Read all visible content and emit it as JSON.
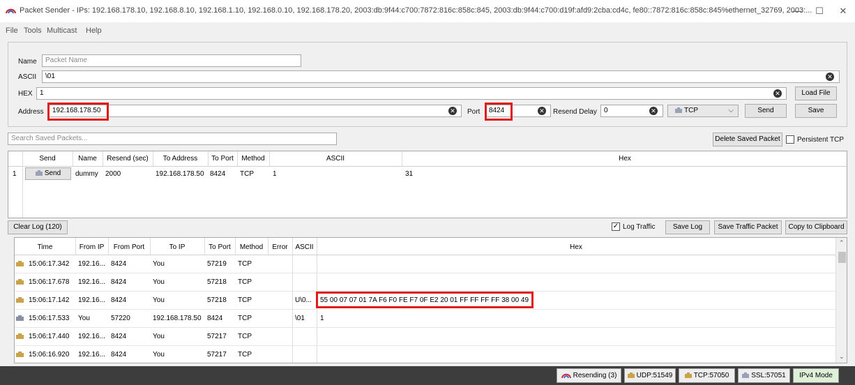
{
  "window": {
    "title": "Packet Sender - IPs: 192.168.178.10, 192.168.8.10, 192.168.1.10, 192.168.0.10, 192.168.178.20, 2003:db:9f44:c700:7872:816c:858c:845, 2003:db:9f44:c700:d19f:afd9:2cba:cd4c, fe80::7872:816c:858c:845%ethernet_32769, 2003:...",
    "minimize": "—",
    "maximize": "☐",
    "close": "✕"
  },
  "menu": [
    "File",
    "Tools",
    "Multicast",
    "Help"
  ],
  "packet_form": {
    "name_label": "Name",
    "name_placeholder": "Packet Name",
    "ascii_label": "ASCII",
    "ascii_value": "\\01",
    "hex_label": "HEX",
    "hex_value": "1",
    "load_file": "Load File",
    "address_label": "Address",
    "address_value": "192.168.178.50",
    "port_label": "Port",
    "port_value": "8424",
    "resend_label": "Resend Delay",
    "resend_value": "0",
    "protocol": "TCP",
    "send": "Send",
    "save": "Save"
  },
  "saved": {
    "search_placeholder": "Search Saved Packets...",
    "delete_button": "Delete Saved Packet",
    "persistent_tcp": "Persistent TCP",
    "columns": [
      "Send",
      "Name",
      "Resend (sec)",
      "To Address",
      "To Port",
      "Method",
      "ASCII",
      "Hex"
    ],
    "rows": [
      {
        "num": "1",
        "send": "Send",
        "name": "dummy",
        "resend": "2000",
        "address": "192.168.178.50",
        "port": "8424",
        "method": "TCP",
        "ascii": "1",
        "hex": "31"
      }
    ]
  },
  "log": {
    "clear_button": "Clear Log (120)",
    "log_traffic": "Log Traffic",
    "save_log": "Save Log",
    "save_traffic_packet": "Save Traffic Packet",
    "copy_clipboard": "Copy to Clipboard",
    "columns": [
      "Time",
      "From IP",
      "From Port",
      "To IP",
      "To Port",
      "Method",
      "Error",
      "ASCII",
      "Hex"
    ],
    "rows": [
      {
        "time": "15:06:17.342",
        "from_ip": "192.16...",
        "from_port": "8424",
        "to_ip": "You",
        "to_port": "57219",
        "method": "TCP",
        "error": "",
        "ascii": "",
        "hex": ""
      },
      {
        "time": "15:06:17.678",
        "from_ip": "192.16...",
        "from_port": "8424",
        "to_ip": "You",
        "to_port": "57218",
        "method": "TCP",
        "error": "",
        "ascii": "",
        "hex": ""
      },
      {
        "time": "15:06:17.142",
        "from_ip": "192.16...",
        "from_port": "8424",
        "to_ip": "You",
        "to_port": "57218",
        "method": "TCP",
        "error": "",
        "ascii": "U\\0...",
        "hex": "55 00 07 07 01 7A F6 F0 FE F7 0F E2 20 01 FF FF FF FF 38 00 49"
      },
      {
        "time": "15:06:17.533",
        "from_ip": "You",
        "from_port": "57220",
        "to_ip": "192.168.178.50",
        "to_port": "8424",
        "method": "TCP",
        "error": "",
        "ascii": "\\01",
        "hex": "1"
      },
      {
        "time": "15:06:17.440",
        "from_ip": "192.16...",
        "from_port": "8424",
        "to_ip": "You",
        "to_port": "57217",
        "method": "TCP",
        "error": "",
        "ascii": "",
        "hex": ""
      },
      {
        "time": "15:06:16.920",
        "from_ip": "192.16...",
        "from_port": "8424",
        "to_ip": "You",
        "to_port": "57217",
        "method": "TCP",
        "error": "",
        "ascii": "",
        "hex": ""
      }
    ]
  },
  "status": {
    "resending": "Resending (3)",
    "udp": "UDP:51549",
    "tcp": "TCP:57050",
    "ssl": "SSL:57051",
    "mode": "IPv4 Mode"
  },
  "colors": {
    "highlight_red": "#e01b1b",
    "incoming_icon": "#c9a24a",
    "outgoing_icon": "#8a8fa6",
    "status_bar": "#3d3d3d"
  }
}
